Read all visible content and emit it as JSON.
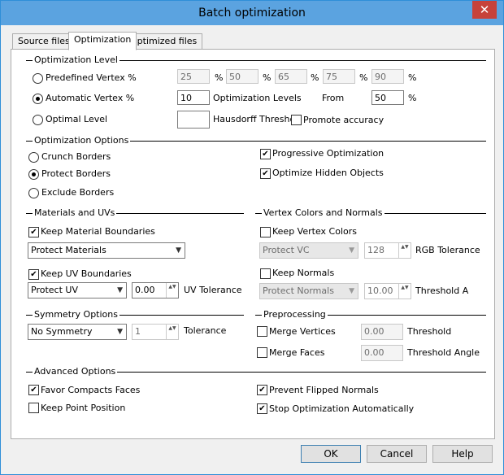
{
  "window": {
    "title": "Batch optimization",
    "close_glyph": "✕"
  },
  "tabs": [
    {
      "label": "Source files"
    },
    {
      "label": "Optimization"
    },
    {
      "label": "Optimized files"
    }
  ],
  "optimization_level": {
    "heading": "Optimization Level",
    "predefined_label": "Predefined Vertex %",
    "predefined_values": [
      "25",
      "50",
      "65",
      "75",
      "90"
    ],
    "percent": "%",
    "automatic_label": "Automatic Vertex %",
    "levels_value": "10",
    "levels_label": "Optimization Levels",
    "from_label": "From",
    "from_value": "50",
    "optimal_label": "Optimal Level",
    "hausdorff_value": "",
    "hausdorff_label": "Hausdorff Thresho",
    "promote_label": "Promote accuracy"
  },
  "optimization_options": {
    "heading": "Optimization Options",
    "crunch": "Crunch Borders",
    "protect": "Protect Borders",
    "exclude": "Exclude Borders",
    "progressive": "Progressive Optimization",
    "hidden": "Optimize Hidden Objects"
  },
  "materials": {
    "heading": "Materials and UVs",
    "keep_material": "Keep Material Boundaries",
    "material_combo": "Protect Materials",
    "keep_uv": "Keep UV Boundaries",
    "uv_combo": "Protect UV",
    "uv_tol_value": "0.00",
    "uv_tol_label": "UV Tolerance"
  },
  "vertex_colors": {
    "heading": "Vertex Colors and Normals",
    "keep_vc": "Keep Vertex Colors",
    "vc_combo": "Protect VC",
    "rgb_value": "128",
    "rgb_label": "RGB Tolerance",
    "keep_normals": "Keep Normals",
    "normals_combo": "Protect Normals",
    "thr_value": "10.00",
    "thr_label": "Threshold Ang"
  },
  "symmetry": {
    "heading": "Symmetry Options",
    "combo": "No Symmetry",
    "tol_value": "1",
    "tol_label": "Tolerance"
  },
  "preprocessing": {
    "heading": "Preprocessing",
    "merge_vertices": "Merge Vertices",
    "mv_value": "0.00",
    "mv_label": "Threshold",
    "merge_faces": "Merge Faces",
    "mf_value": "0.00",
    "mf_label": "Threshold Angle"
  },
  "advanced": {
    "heading": "Advanced Options",
    "favor": "Favor Compacts Faces",
    "keep_point": "Keep Point Position",
    "prevent": "Prevent Flipped Normals",
    "stop": "Stop Optimization Automatically"
  },
  "buttons": {
    "ok": "OK",
    "cancel": "Cancel",
    "help": "Help"
  },
  "check_glyph": "✔",
  "combo_arrow": "▼",
  "spin_glyph": "▲▼"
}
